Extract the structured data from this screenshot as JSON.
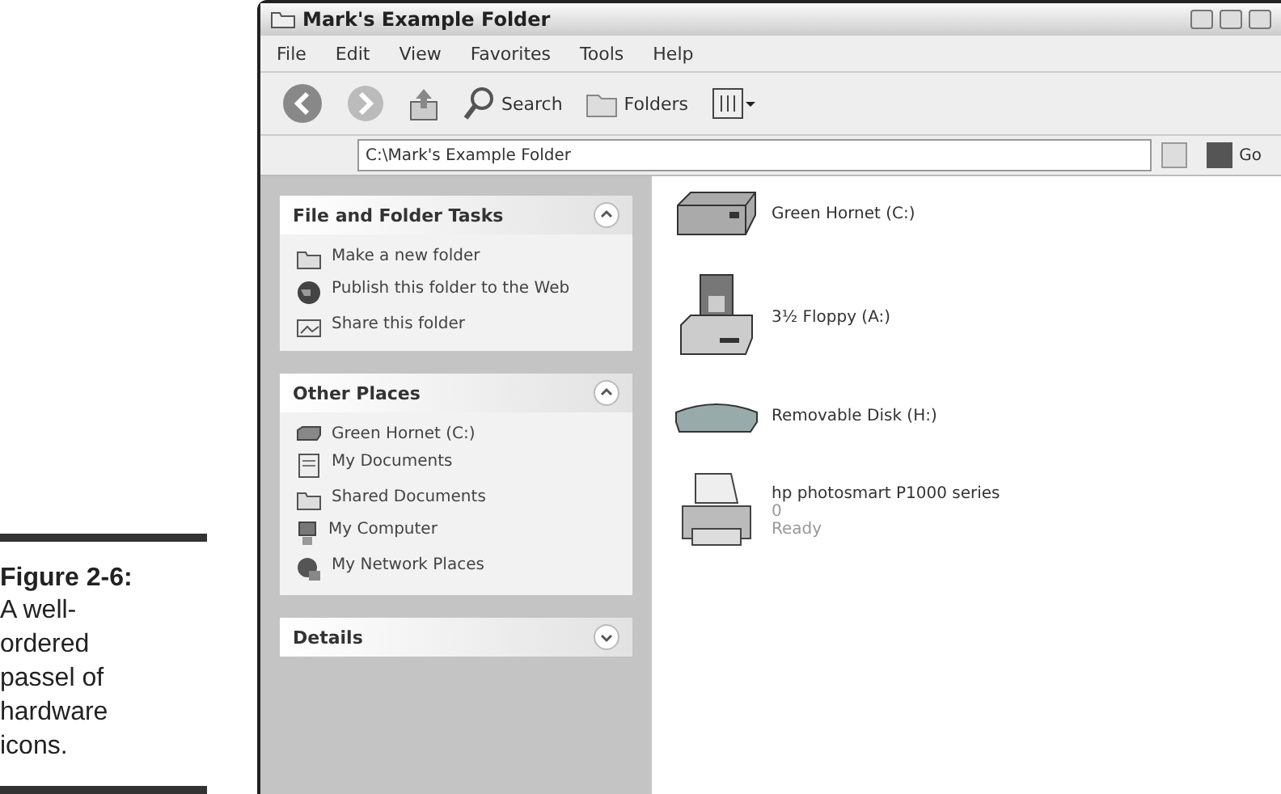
{
  "caption": {
    "label": "Figure 2-6:",
    "text": "A well-ordered passel of hardware icons."
  },
  "window": {
    "title": "Mark's Example Folder"
  },
  "menu": [
    "File",
    "Edit",
    "View",
    "Favorites",
    "Tools",
    "Help"
  ],
  "toolbar": [
    {
      "kind": "back"
    },
    {
      "kind": "forward"
    },
    {
      "kind": "up"
    },
    {
      "kind": "search",
      "label": "Search"
    },
    {
      "kind": "folders",
      "label": "Folders"
    },
    {
      "kind": "views"
    }
  ],
  "address": {
    "value": "C:\\Mark's Example Folder",
    "go": "Go"
  },
  "sidebar": {
    "panels": [
      {
        "title": "File and Folder Tasks",
        "expanded": true,
        "items": [
          {
            "kind": "folder",
            "label": "Make a new folder"
          },
          {
            "kind": "globe",
            "label": "Publish this folder to the Web"
          },
          {
            "kind": "share",
            "label": "Share this folder"
          }
        ]
      },
      {
        "title": "Other Places",
        "expanded": true,
        "items": [
          {
            "kind": "drive",
            "label": "Green Hornet (C:)"
          },
          {
            "kind": "documents",
            "label": "My Documents"
          },
          {
            "kind": "folder",
            "label": "Shared Documents"
          },
          {
            "kind": "computer",
            "label": "My Computer"
          },
          {
            "kind": "network",
            "label": "My Network Places"
          }
        ]
      },
      {
        "title": "Details",
        "expanded": false
      }
    ]
  },
  "items": [
    {
      "kind": "hard-disk",
      "name": "Green Hornet (C:)"
    },
    {
      "kind": "floppy",
      "name": "3½ Floppy (A:)"
    },
    {
      "kind": "removable",
      "name": "Removable Disk (H:)"
    },
    {
      "kind": "printer",
      "name": "hp photosmart P1000 series",
      "details": [
        "0",
        "Ready"
      ]
    }
  ]
}
